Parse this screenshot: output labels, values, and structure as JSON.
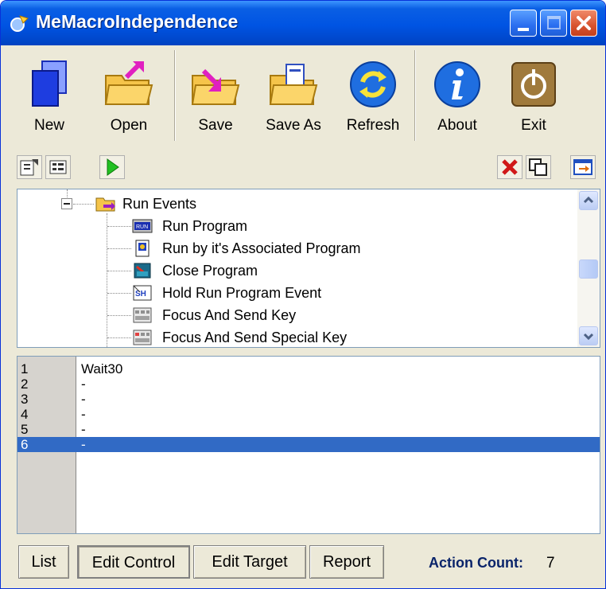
{
  "window": {
    "title": "MeMacroIndependence"
  },
  "toolbar": {
    "new_label": "New",
    "open_label": "Open",
    "save_label": "Save",
    "save_as_label": "Save As",
    "refresh_label": "Refresh",
    "about_label": "About",
    "exit_label": "Exit"
  },
  "small_toolbar": {
    "icons": [
      "properties-icon",
      "list-view-icon",
      "play-icon",
      "delete-icon",
      "window-icon",
      "export-icon"
    ]
  },
  "tree": {
    "parent": {
      "label": "Run Events",
      "icon": "folder-arrow-icon",
      "expanded": true
    },
    "items": [
      {
        "label": "Run Program",
        "icon": "run-program-icon"
      },
      {
        "label": "Run by it's Associated Program",
        "icon": "associated-program-icon"
      },
      {
        "label": "Close Program",
        "icon": "close-program-icon"
      },
      {
        "label": "Hold Run Program Event",
        "icon": "hold-event-icon"
      },
      {
        "label": "Focus And Send Key",
        "icon": "send-key-icon"
      },
      {
        "label": "Focus And Send Special Key",
        "icon": "send-special-key-icon"
      }
    ]
  },
  "editor": {
    "lines": [
      {
        "num": "1",
        "text": "Wait30"
      },
      {
        "num": "2",
        "text": "-"
      },
      {
        "num": "3",
        "text": "-"
      },
      {
        "num": "4",
        "text": "-"
      },
      {
        "num": "5",
        "text": "-"
      },
      {
        "num": "6",
        "text": "-"
      }
    ],
    "selected_line": "6"
  },
  "bottom": {
    "tabs": [
      "List",
      "Edit Control",
      "Edit Target",
      "Report"
    ],
    "active_tab": "Edit Control",
    "action_count_label": "Action Count:",
    "action_count_value": "7"
  },
  "colors": {
    "titlebar": "#0054e3",
    "selection": "#316ac5",
    "count_label": "#0a246a"
  }
}
